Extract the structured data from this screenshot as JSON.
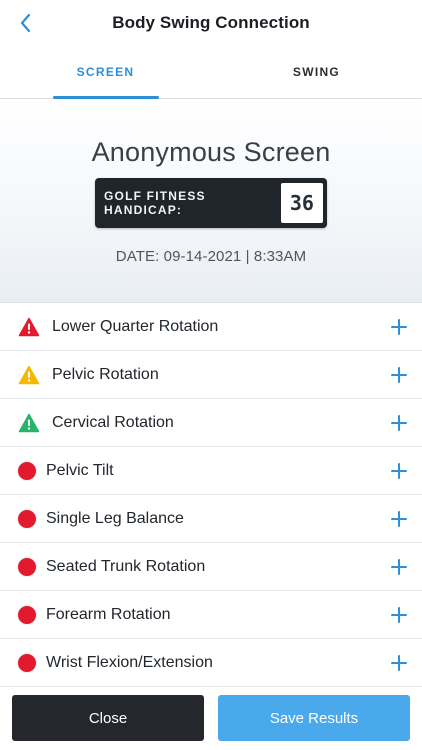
{
  "header": {
    "title": "Body Swing Connection",
    "back_icon": "chevron-left-icon"
  },
  "tabs": [
    {
      "label": "SCREEN",
      "active": true
    },
    {
      "label": "SWING",
      "active": false
    }
  ],
  "hero": {
    "title": "Anonymous Screen",
    "handicap_label": "GOLF FITNESS HANDICAP:",
    "handicap_value": "36",
    "date": "DATE: 09-14-2021 | 8:33AM"
  },
  "items": [
    {
      "label": "Lower Quarter Rotation",
      "status": "warning-red",
      "icon": "warning-triangle-icon"
    },
    {
      "label": "Pelvic Rotation",
      "status": "warning-yellow",
      "icon": "warning-triangle-icon"
    },
    {
      "label": "Cervical Rotation",
      "status": "warning-green",
      "icon": "warning-triangle-icon"
    },
    {
      "label": "Pelvic Tilt",
      "status": "red-dot",
      "icon": "red-dot-icon"
    },
    {
      "label": "Single Leg Balance",
      "status": "red-dot",
      "icon": "red-dot-icon"
    },
    {
      "label": "Seated Trunk Rotation",
      "status": "red-dot",
      "icon": "red-dot-icon"
    },
    {
      "label": "Forearm Rotation",
      "status": "red-dot",
      "icon": "red-dot-icon"
    },
    {
      "label": "Wrist Flexion/Extension",
      "status": "red-dot",
      "icon": "red-dot-icon"
    }
  ],
  "footer": {
    "close_label": "Close",
    "save_label": "Save Results"
  },
  "colors": {
    "accent": "#2d8fd6",
    "red": "#e3192d",
    "yellow": "#f5b800",
    "green": "#27b36a",
    "dark": "#24282d",
    "save": "#4aa9ea"
  }
}
